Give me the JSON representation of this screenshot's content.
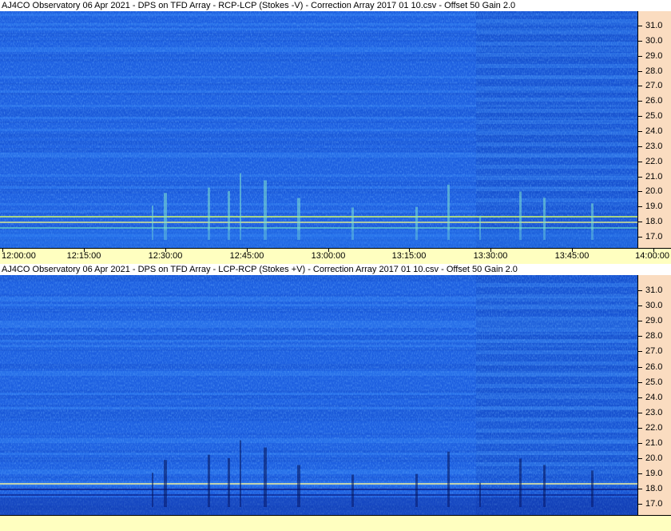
{
  "panels": [
    {
      "title": "AJ4CO Observatory 06 Apr 2021  -  DPS on TFD Array  -  RCP-LCP (Stokes -V)  -  Correction Array 2017 01 10.csv  -  Offset 50  Gain 2.0",
      "polarity": "bright"
    },
    {
      "title": "AJ4CO Observatory 06 Apr 2021  -  DPS on TFD Array  -  LCP-RCP (Stokes +V)  -  Correction Array 2017 01 10.csv  -  Offset 50  Gain 2.0",
      "polarity": "dark"
    }
  ],
  "frequency_labels": [
    "31.0",
    "30.0",
    "29.0",
    "28.0",
    "27.0",
    "26.0",
    "25.0",
    "24.0",
    "23.0",
    "22.0",
    "21.0",
    "20.0",
    "19.0",
    "18.0",
    "17.0"
  ],
  "time_labels": [
    "12:00:00",
    "12:15:00",
    "12:30:00",
    "12:45:00",
    "13:00:00",
    "13:15:00",
    "13:30:00",
    "13:45:00",
    "14:00:00"
  ],
  "colors": {
    "spectrogram_base": "#1d5fe0",
    "freq_axis_bg": "#fadcc0",
    "time_axis_bg": "#ffffc0"
  }
}
